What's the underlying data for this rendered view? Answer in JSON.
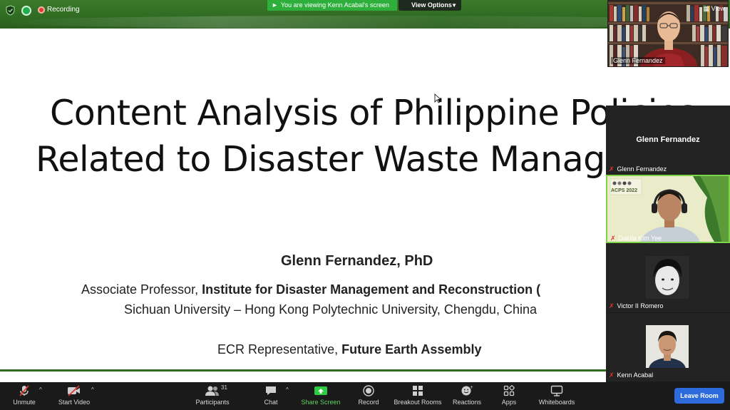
{
  "topbar": {
    "recording_label": "Recording",
    "viewing_text": "You are viewing Kenn Acabal's screen",
    "view_options_label": "View Options"
  },
  "slide": {
    "title_line1": "Content Analysis of Philippine Policies",
    "title_line2": "Related to Disaster Waste Management",
    "author": "Glenn Fernandez, PhD",
    "affil_prefix": "Associate Professor, ",
    "affil_bold": "Institute for Disaster Management and Reconstruction (",
    "affil2": "Sichuan University – Hong Kong Polytechnic University, Chengdu, China",
    "ecr_prefix": "ECR Representative, ",
    "ecr_bold": "Future Earth Assembly"
  },
  "speaker": {
    "name": "Glenn Fernandez",
    "view_label": "View"
  },
  "gallery": {
    "header_name": "Glenn Fernandez",
    "participants": [
      {
        "name": "Glenn Fernandez",
        "muted": true
      },
      {
        "name": "Dakila Kim Yee",
        "muted": true
      },
      {
        "name": "Victor II Romero",
        "muted": true
      },
      {
        "name": "Kenn Acabal",
        "muted": true
      }
    ],
    "acps_badge": "ACPS 2022"
  },
  "toolbar": {
    "unmute": "Unmute",
    "start_video": "Start Video",
    "participants": "Participants",
    "participants_count": "31",
    "chat": "Chat",
    "share_screen": "Share Screen",
    "record": "Record",
    "breakout_rooms": "Breakout Rooms",
    "reactions": "Reactions",
    "apps": "Apps",
    "whiteboards": "Whiteboards",
    "leave_room": "Leave Room"
  },
  "colors": {
    "topbar_green": "#2f6b22",
    "viewing_pill": "#2eaf3c",
    "leave_button": "#2d6bdc",
    "share_green": "#5fd35f",
    "muted_red": "#e0352b"
  }
}
